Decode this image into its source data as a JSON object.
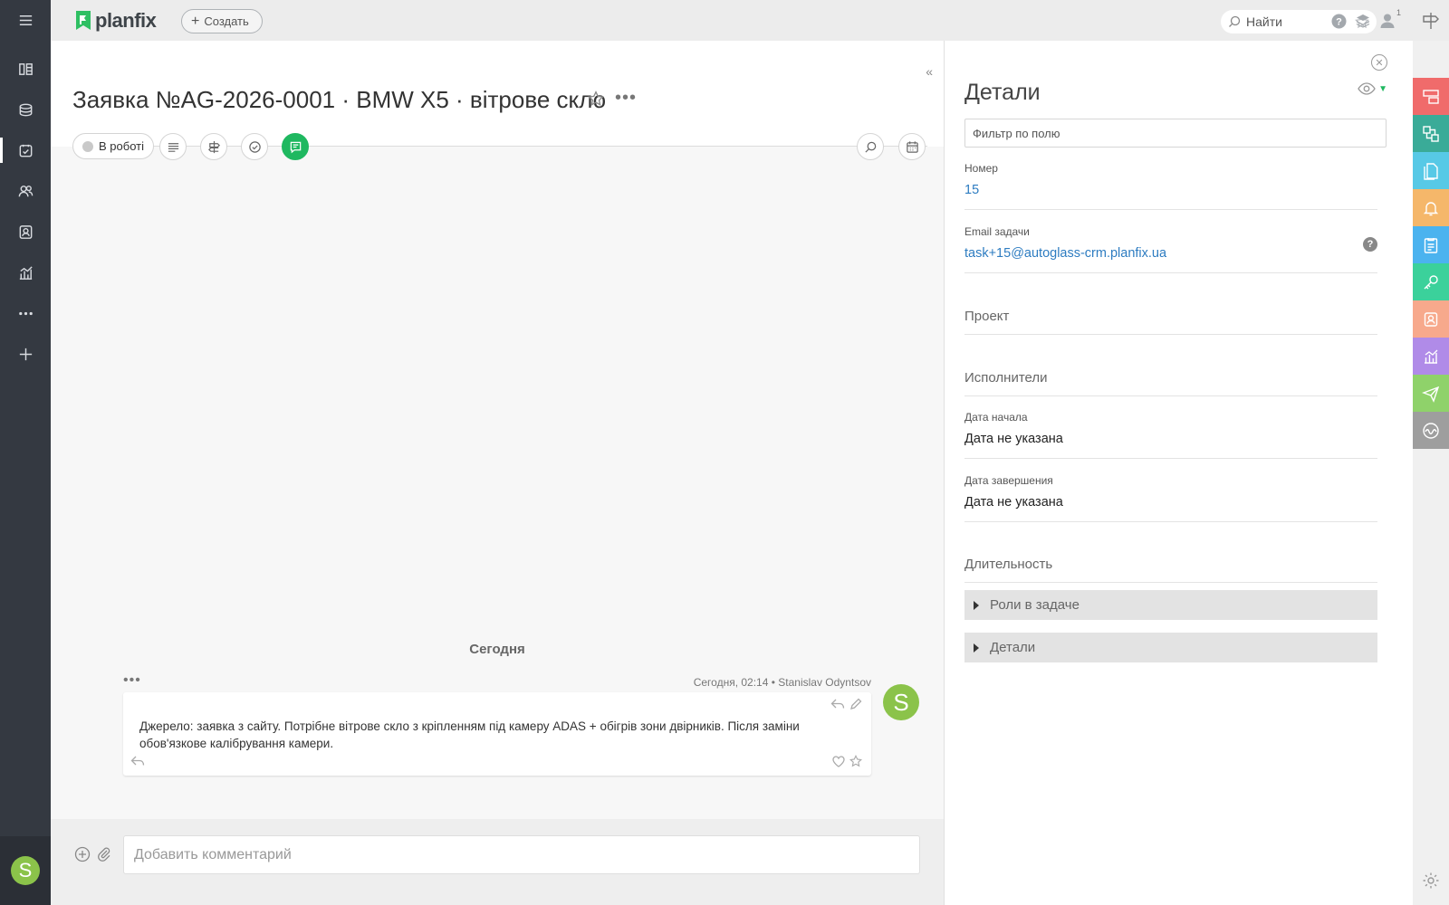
{
  "app": {
    "logo_text": "planfix",
    "create_label": "Создать",
    "search_placeholder": "Найти",
    "profile_badge": "1"
  },
  "nav": {
    "items": [
      "menu-icon",
      "board-icon",
      "inbox-icon",
      "tasks-icon",
      "people-icon",
      "contacts-icon",
      "reports-icon",
      "more-icon",
      "add-icon"
    ],
    "user_initial": "S"
  },
  "task": {
    "title": "Заявка №AG-2026-0001 · BMW X5 · вітрове скло",
    "status": "В роботі",
    "day_label": "Сегодня",
    "comment": {
      "meta": "Сегодня, 02:14 • Stanislav Odyntsov",
      "text": "Джерело: заявка з сайту. Потрібне вітрове скло з кріпленням під камеру ADAS + обігрів зони двірників. Після заміни обов'язкове калібрування камери.",
      "author_initial": "S"
    },
    "composer_placeholder": "Добавить комментарий"
  },
  "details": {
    "title": "Детали",
    "filter_placeholder": "Фильтр по полю",
    "number_label": "Номер",
    "number_value": "15",
    "email_label": "Email задачи",
    "email_value": "task+15@autoglass-crm.planfix.ua",
    "project_label": "Проект",
    "executors_label": "Исполнители",
    "start_label": "Дата начала",
    "start_value": "Дата не указана",
    "end_label": "Дата завершения",
    "end_value": "Дата не указана",
    "duration_label": "Длительность",
    "section_roles": "Роли в задаче",
    "section_details": "Детали"
  },
  "colors": {
    "accent_green": "#1fb860",
    "right_tiles": [
      "#f06b6b",
      "#3aab98",
      "#57c9e6",
      "#f5b76a",
      "#4bb3ef",
      "#3bd19b",
      "#f7a98c",
      "#b08be8",
      "#8fd26a",
      "#9e9e9e"
    ]
  }
}
